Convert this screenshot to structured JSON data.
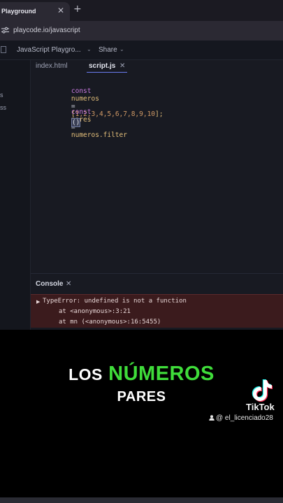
{
  "browser": {
    "tab_title": "Playground",
    "tab_close": "✕",
    "new_tab": "+",
    "url": "playcode.io/javascript"
  },
  "app_header": {
    "project_name": "JavaScript Playgro...",
    "project_chevron": "⌄",
    "share_label": "Share",
    "share_chevron": "⌄"
  },
  "sidebar": {
    "items": [
      "s",
      "ss"
    ]
  },
  "editor": {
    "tabs": [
      {
        "label": "index.html",
        "active": false
      },
      {
        "label": "script.js",
        "active": true
      }
    ],
    "tab_close": "✕",
    "code": {
      "line1": {
        "kw": "const",
        "name": "numeros",
        "eq": "=",
        "open": "[",
        "values": "1,2,3,4,5,6,7,8,9,10",
        "close": "];"
      },
      "line2": {
        "kw": "const",
        "name": "pares",
        "eq": "=",
        "expr": "numeros.filter"
      },
      "line3": {
        "paren": "()"
      }
    }
  },
  "console": {
    "title": "Console",
    "close": "✕",
    "error": {
      "message": "TypeError: undefined is not a function",
      "stack1": "at <anonymous>:3:21",
      "stack2": "at mn (<anonymous>:16:5455)"
    }
  },
  "caption": {
    "word1": "LOS",
    "word2": "NÚMEROS",
    "line2": "PARES"
  },
  "watermark": {
    "brand": "TikTok",
    "handle": "@ el_licenciado28"
  },
  "colors": {
    "caption_highlight": "#3fdc3a",
    "error_bg": "#3b1b1d",
    "editor_bg": "#181a22"
  }
}
